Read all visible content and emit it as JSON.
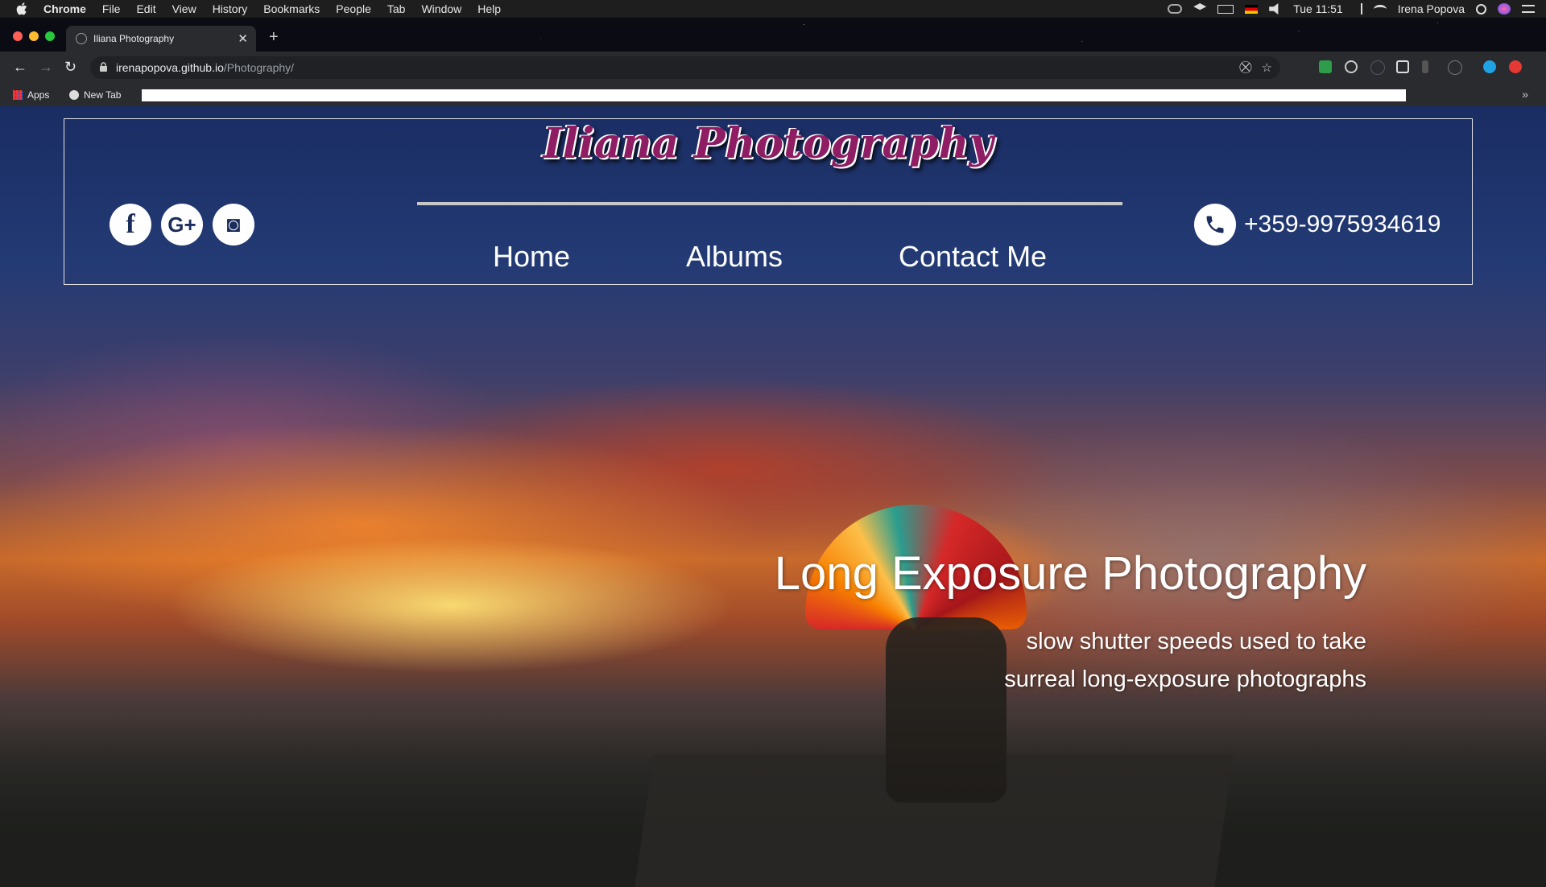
{
  "menubar": {
    "app": "Chrome",
    "items": [
      "File",
      "Edit",
      "View",
      "History",
      "Bookmarks",
      "People",
      "Tab",
      "Window",
      "Help"
    ],
    "clock": "Tue 11:51",
    "user": "Irena Popova"
  },
  "browser": {
    "tab_title": "Iliana Photography",
    "url_host": "irenapopova.github.io",
    "url_path": "/Photography/",
    "bookmarks": [
      {
        "label": "Apps",
        "icon": "apps-grid-icon"
      },
      {
        "label": "New Tab",
        "icon": "globe-icon"
      }
    ]
  },
  "site": {
    "logo_text": "Iliana Photography",
    "nav": [
      "Home",
      "Albums",
      "Contact Me"
    ],
    "social": [
      {
        "name": "facebook",
        "glyph": "f"
      },
      {
        "name": "google-plus",
        "glyph": "G+"
      },
      {
        "name": "instagram",
        "glyph": "◙"
      }
    ],
    "phone": "+359-9975934619",
    "hero": {
      "title": "Long Exposure Photography",
      "subtitle_line1": "slow shutter speeds used to take",
      "subtitle_line2": "surreal long-exposure photographs"
    }
  },
  "colors": {
    "logo": "#8e1d63",
    "header_border": "#e6e6e6"
  }
}
